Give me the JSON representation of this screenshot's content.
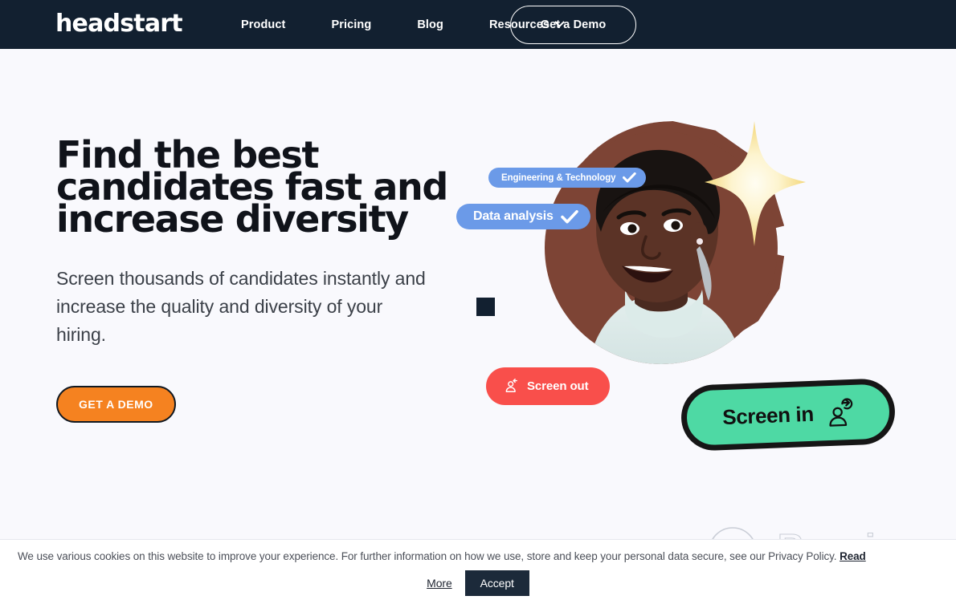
{
  "brand": {
    "logo_text": "headstart",
    "colors": {
      "navbar_bg": "#122030",
      "page_bg": "#f9f9fd",
      "accent_orange": "#f58220",
      "pill_blue": "#6b9ae8",
      "screen_out_red": "#f94f4b",
      "screen_in_green": "#4ed9a4",
      "blob_brown": "#7d4435",
      "sparkle_yellow": "#f7e9a0",
      "square_dark": "#122030"
    }
  },
  "nav": {
    "items": [
      {
        "label": "Product"
      },
      {
        "label": "Pricing"
      },
      {
        "label": "Blog"
      },
      {
        "label": "Resources",
        "has_dropdown": true
      }
    ],
    "cta_label": "Get a Demo"
  },
  "hero": {
    "headline_lines": [
      "Find the best",
      "candidates fast and",
      "increase diversity"
    ],
    "subhead": "Screen thousands of candidates instantly and increase the quality and diversity of your hiring.",
    "cta_label": "GET A DEMO",
    "artwork": {
      "pill_engineering": "Engineering & Technology",
      "pill_data": "Data analysis",
      "screen_out_label": "Screen out",
      "screen_in_label": "Screen in"
    }
  },
  "cookie": {
    "message_before_links": "We use various cookies on this website to improve your experience. For further information on how we use, store and keep your personal data secure, see our Privacy Policy.",
    "read_link": "Read",
    "more_label": "More",
    "accept_label": "Accept"
  },
  "watermark": {
    "text": "Revain"
  }
}
